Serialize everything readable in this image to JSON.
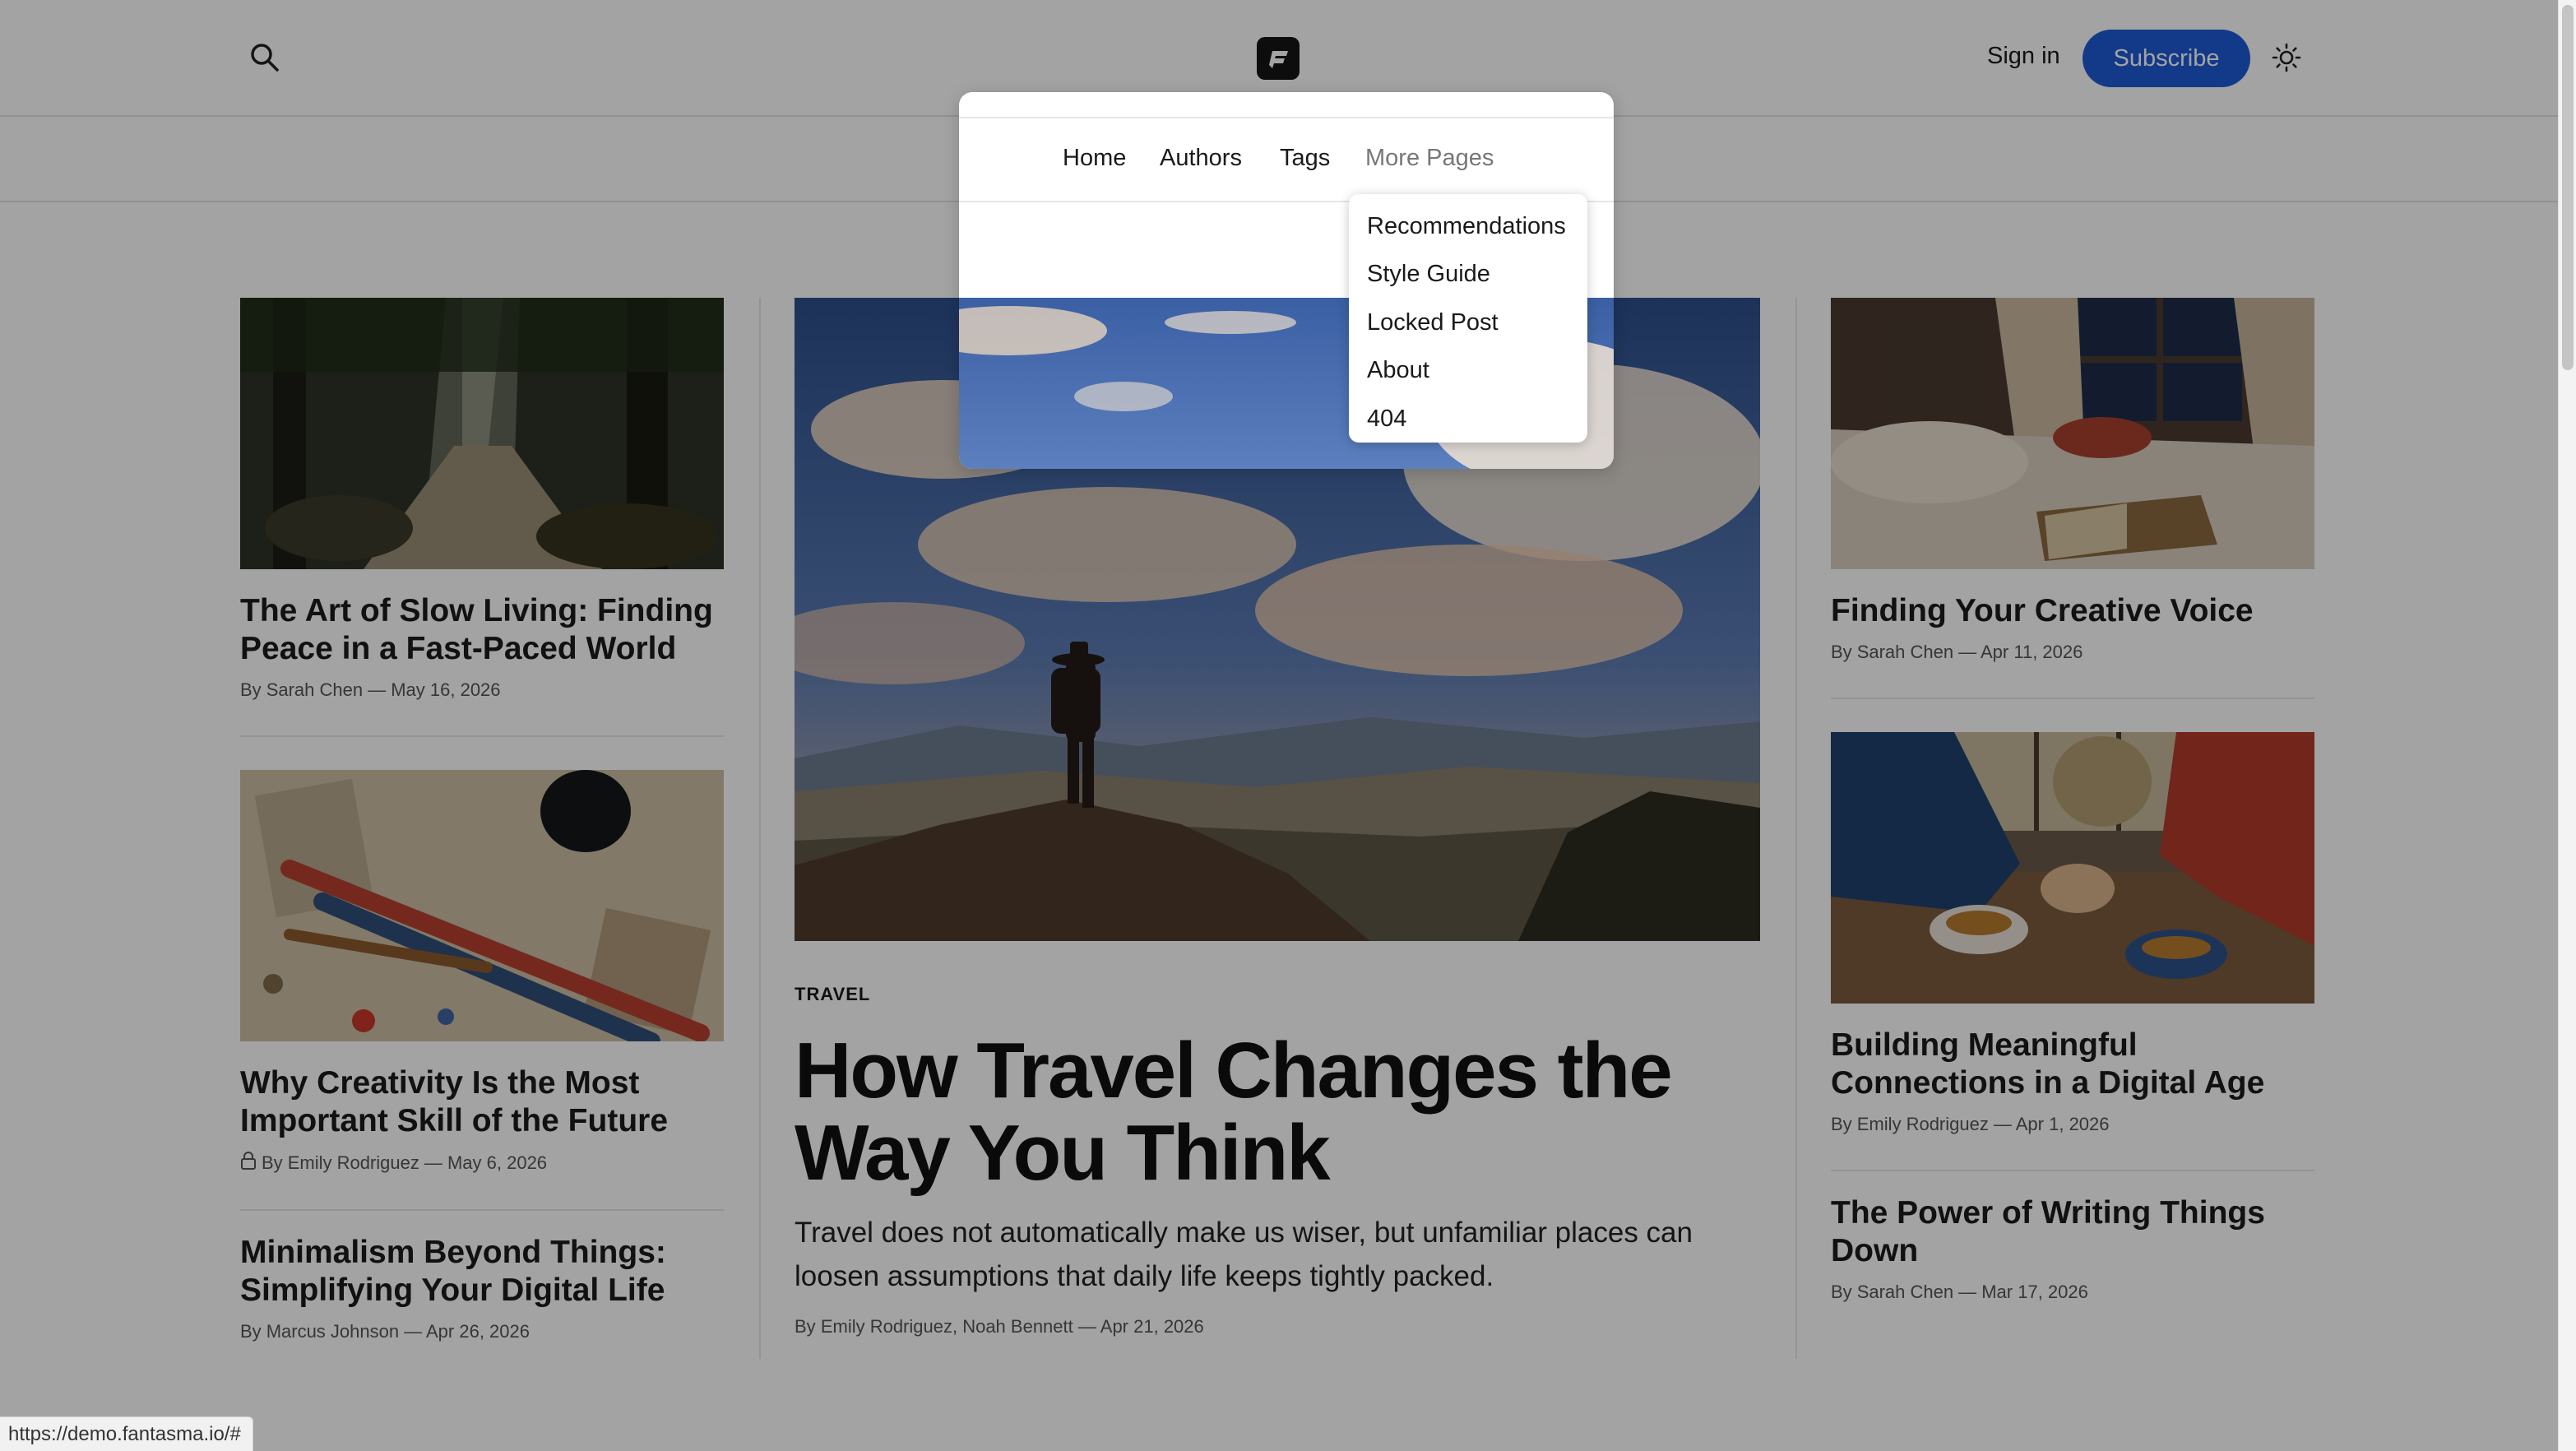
{
  "header": {
    "sign_in": "Sign in",
    "subscribe": "Subscribe"
  },
  "nav": {
    "items": [
      "Home",
      "Authors",
      "Tags",
      "More Pages"
    ],
    "more_pages_menu": [
      "Recommendations",
      "Style Guide",
      "Locked Post",
      "About",
      "404"
    ]
  },
  "left_column": [
    {
      "title": "The Art of Slow Living: Finding Peace in a Fast-Paced World",
      "by": "By",
      "author": "Sarah Chen",
      "date": "— May 16, 2026",
      "locked": false
    },
    {
      "title": "Why Creativity Is the Most Important Skill of the Future",
      "by": "By",
      "author": "Emily Rodriguez",
      "date": "— May 6, 2026",
      "locked": true
    },
    {
      "title": "Minimalism Beyond Things: Simplifying Your Digital Life",
      "by": "By",
      "author": "Marcus Johnson",
      "date": "— Apr 26, 2026",
      "locked": false
    }
  ],
  "featured": {
    "tag": "TRAVEL",
    "title": "How Travel Changes the Way You Think",
    "excerpt": "Travel does not automatically make us wiser, but unfamiliar places can loosen assumptions that daily life keeps tightly packed.",
    "by": "By",
    "authors": "Emily Rodriguez, Noah Bennett",
    "date": "— Apr 21, 2026"
  },
  "right_column": [
    {
      "title": "Finding Your Creative Voice",
      "by": "By",
      "author": "Sarah Chen",
      "date": "— Apr 11, 2026"
    },
    {
      "title": "Building Meaningful Connections in a Digital Age",
      "by": "By",
      "author": "Emily Rodriguez",
      "date": "— Apr 1, 2026"
    },
    {
      "title": "The Power of Writing Things Down",
      "by": "By",
      "author": "Sarah Chen",
      "date": "— Mar 17, 2026"
    }
  ],
  "status_bar": {
    "url": "https://demo.fantasma.io/#"
  },
  "colors": {
    "accent": "#1e5bd6",
    "logo": "#151515"
  }
}
